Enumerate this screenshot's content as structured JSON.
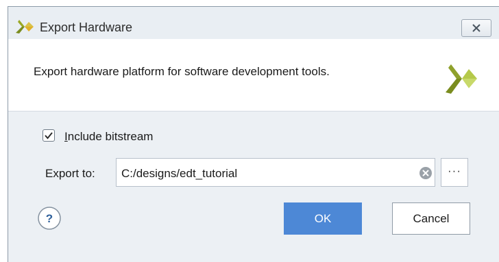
{
  "window": {
    "title": "Export Hardware",
    "app_icon": "xilinx-logo-icon",
    "close_icon": "close-icon"
  },
  "header": {
    "description": "Export hardware platform for software development tools.",
    "logo_icon": "xilinx-logo-icon"
  },
  "options": {
    "include_bitstream_label": "Include bitstream",
    "include_bitstream_mnemonic": "I",
    "include_bitstream_rest": "nclude bitstream",
    "include_bitstream_checked": true
  },
  "export": {
    "label": "Export to:",
    "path_value": "C:/designs/edt_tutorial",
    "clear_icon": "clear-icon",
    "browse_label": "···"
  },
  "footer": {
    "help_label": "?",
    "ok_label": "OK",
    "cancel_label": "Cancel"
  },
  "colors": {
    "accent": "#4d88d6",
    "logo_dark": "#7a8c1e",
    "logo_light": "#c8d96a"
  }
}
